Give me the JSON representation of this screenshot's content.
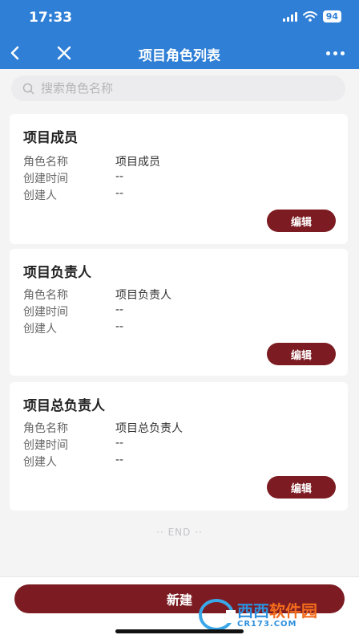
{
  "status_bar": {
    "time": "17:33",
    "battery": "94"
  },
  "nav": {
    "title": "项目角色列表"
  },
  "search": {
    "placeholder": "搜索角色名称"
  },
  "field_labels": {
    "role_name": "角色名称",
    "created_time": "创建时间",
    "creator": "创建人"
  },
  "roles": [
    {
      "title": "项目成员",
      "role_name": "项目成员",
      "created_time": "--",
      "creator": "--",
      "edit_label": "编辑"
    },
    {
      "title": "项目负责人",
      "role_name": "项目负责人",
      "created_time": "--",
      "creator": "--",
      "edit_label": "编辑"
    },
    {
      "title": "项目总负责人",
      "role_name": "项目总负责人",
      "created_time": "--",
      "creator": "--",
      "edit_label": "编辑"
    }
  ],
  "list_end": "·· END ··",
  "bottom": {
    "create_label": "新建"
  },
  "watermark": {
    "main_a": "西西",
    "main_b": "软件园",
    "sub": "CR173.COM"
  },
  "colors": {
    "nav_bg": "#2f7fd6",
    "accent": "#7c1c22",
    "page_bg": "#f4f4f5"
  }
}
